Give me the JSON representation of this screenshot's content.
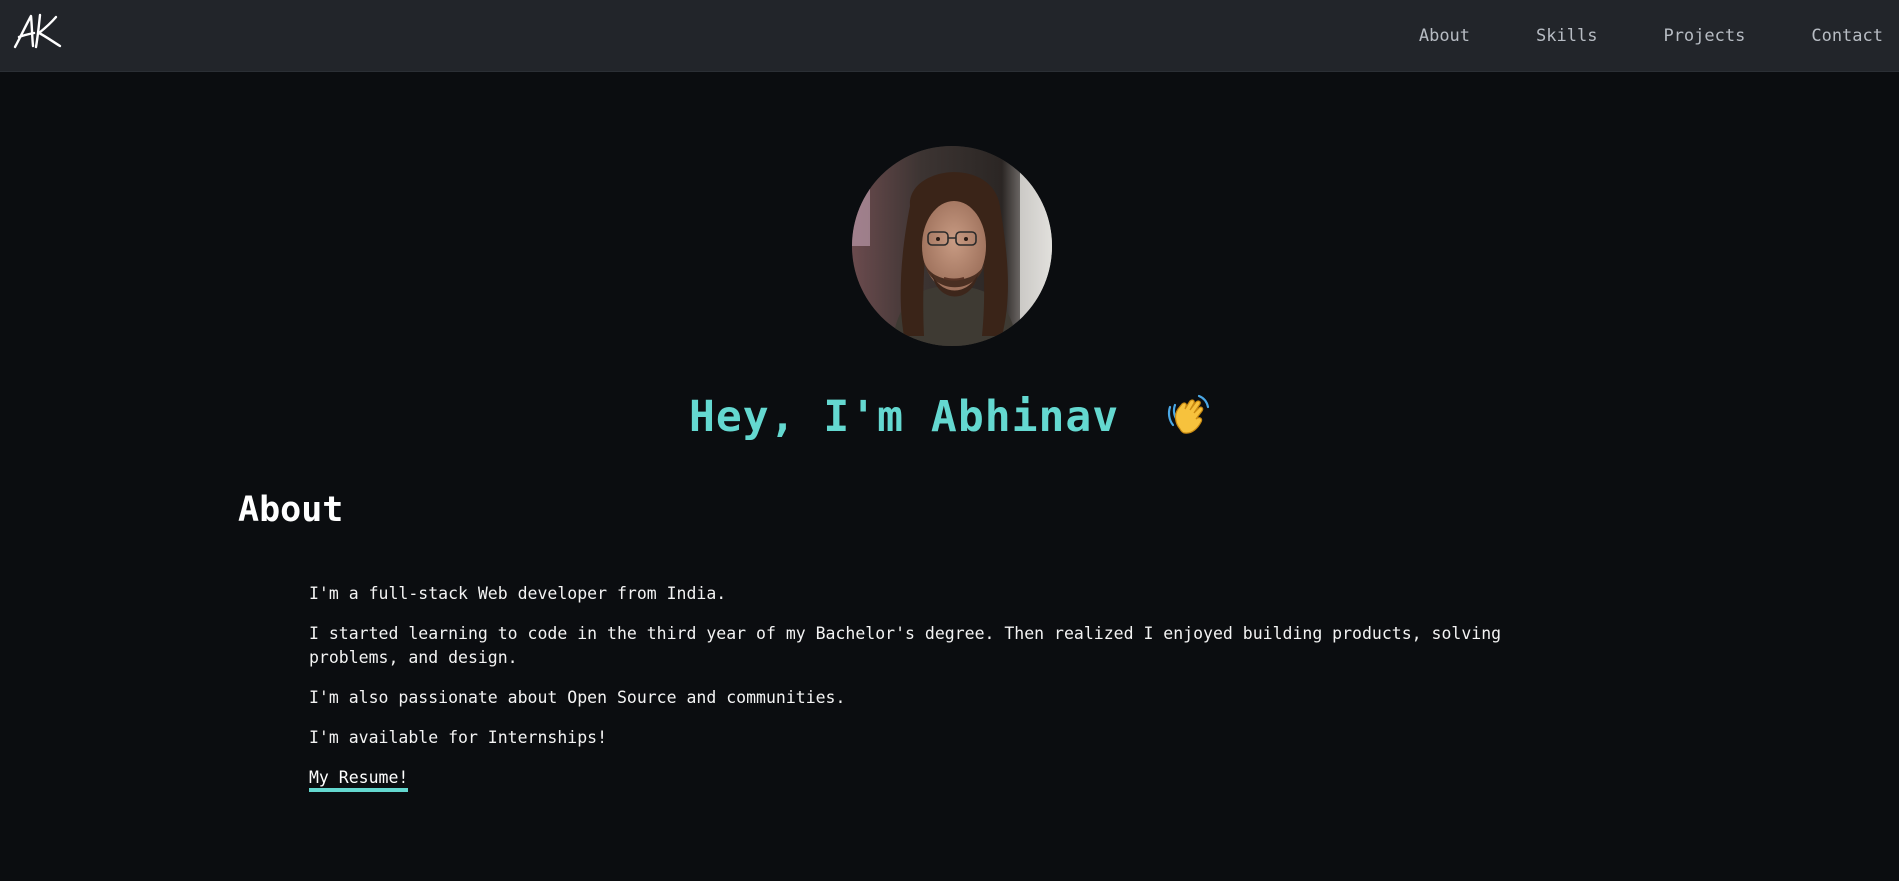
{
  "nav": {
    "logo_text": "AK",
    "links": [
      {
        "label": "About"
      },
      {
        "label": "Skills"
      },
      {
        "label": "Projects"
      },
      {
        "label": "Contact"
      }
    ]
  },
  "hero": {
    "greeting": "Hey, I'm Abhinav",
    "wave_icon": "waving-hand-icon"
  },
  "about": {
    "title": "About",
    "paragraphs": [
      "I'm a full-stack Web developer from India.",
      "I started learning to code in the third year of my Bachelor's degree. Then realized I enjoyed building products, solving problems, and design.",
      "I'm also passionate about Open Source and communities.",
      "I'm available for Internships!"
    ],
    "resume_label": "My Resume!"
  },
  "colors": {
    "background": "#0b0d10",
    "navbar": "#22252a",
    "accent": "#64d8d0",
    "nav_text": "#b7bcc3"
  }
}
